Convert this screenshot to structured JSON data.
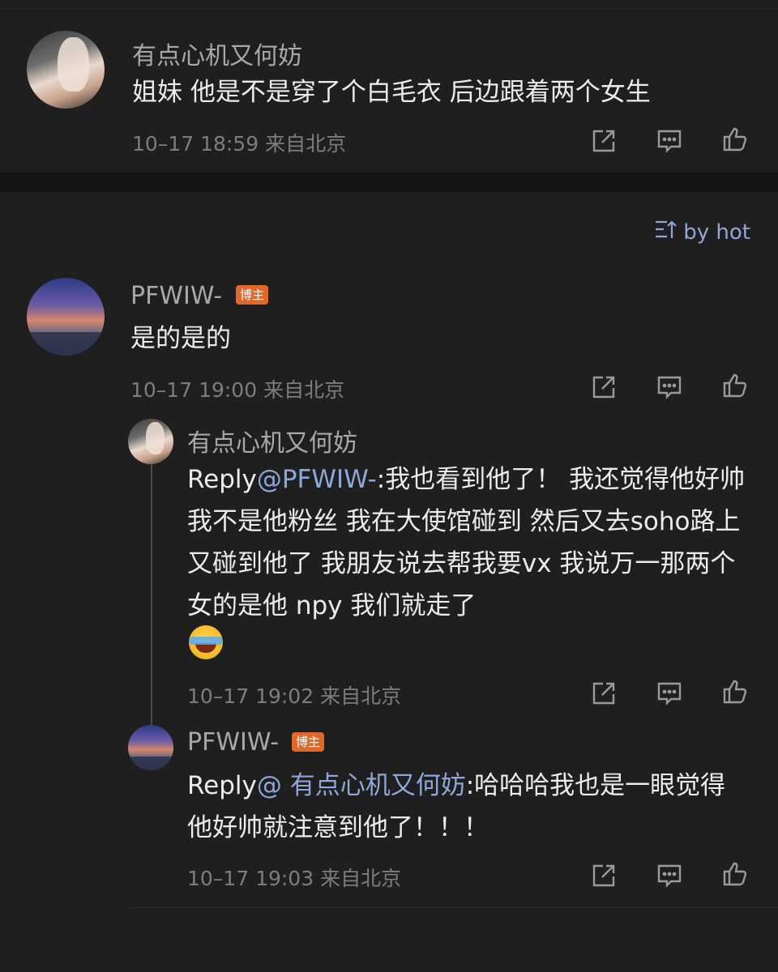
{
  "top_comment": {
    "username": "有点心机又何妨",
    "text": "姐妹 他是不是穿了个白毛衣 后边跟着两个女生",
    "meta": "10–17 18:59 来自北京"
  },
  "sort": {
    "label": "by hot",
    "icon": "sort-icon"
  },
  "main_comment": {
    "username": "PFWIW-",
    "badge": "博主",
    "text": "是的是的",
    "meta": "10–17 19:00 来自北京"
  },
  "replies": [
    {
      "username": "有点心机又何妨",
      "reply_prefix": "Reply",
      "mention": "@PFWIW-",
      "text": ":我也看到他了！ 我还觉得他好帅 我不是他粉丝 我在大使馆碰到 然后又去soho路上又碰到他了 我朋友说去帮我要vx 我说万一那两个女的是他 npy 我们就走了",
      "emoji": "laughing-crying-emoji",
      "meta": "10–17 19:02 来自北京"
    },
    {
      "username": "PFWIW-",
      "badge": "博主",
      "reply_prefix": "Reply",
      "mention": "@ 有点心机又何妨",
      "text": ":哈哈哈我也是一眼觉得他好帅就注意到他了！！！",
      "meta": "10–17 19:03 来自北京"
    }
  ],
  "actions": {
    "share": "share-icon",
    "comment": "comment-icon",
    "like": "like-icon"
  },
  "colors": {
    "background": "#1f1f1f",
    "accent": "#8fa6d8",
    "badge": "#e0692a"
  }
}
